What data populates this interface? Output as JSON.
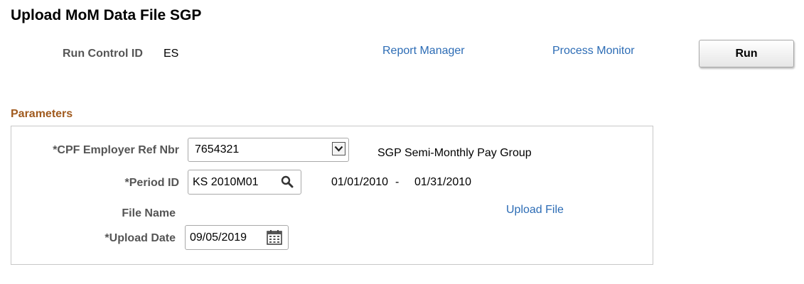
{
  "page": {
    "title": "Upload MoM Data File SGP"
  },
  "header": {
    "run_control_label": "Run Control ID",
    "run_control_value": "ES",
    "report_manager_link": "Report Manager",
    "process_monitor_link": "Process Monitor",
    "run_button": "Run"
  },
  "parameters": {
    "section_title": "Parameters",
    "cpf_employer": {
      "label": "*CPF Employer Ref Nbr",
      "value": "7654321",
      "description": "SGP Semi-Monthly Pay Group"
    },
    "period": {
      "label": "*Period ID",
      "value": "KS 2010M01",
      "start_date": "01/01/2010",
      "separator": "-",
      "end_date": "01/31/2010"
    },
    "file_name": {
      "label": "File Name",
      "upload_link": "Upload File"
    },
    "upload_date": {
      "label": "*Upload Date",
      "value": "09/05/2019"
    }
  },
  "icons": {
    "dropdown": "chevron-down-icon",
    "lookup": "search-icon",
    "calendar": "calendar-icon"
  },
  "colors": {
    "link": "#2c6cb5",
    "section_title": "#a05a1e",
    "label": "#555555"
  }
}
